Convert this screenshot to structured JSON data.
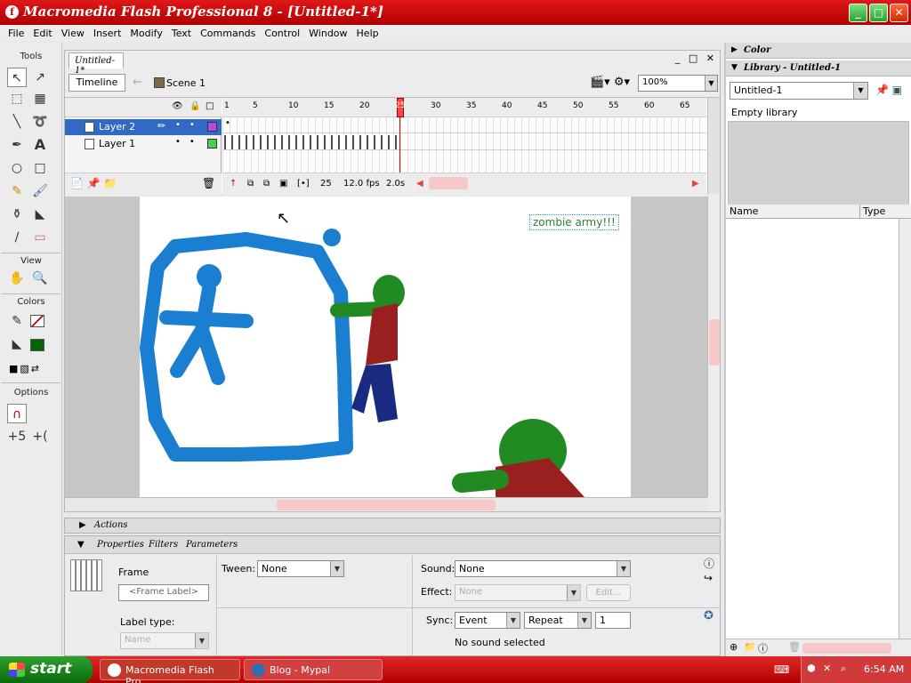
{
  "window": {
    "title": "Macromedia Flash Professional 8 - [Untitled-1*]",
    "app_icon": "f",
    "controls": [
      "_",
      "□",
      "✕"
    ]
  },
  "menu": [
    "File",
    "Edit",
    "View",
    "Insert",
    "Modify",
    "Text",
    "Commands",
    "Control",
    "Window",
    "Help"
  ],
  "tools": {
    "title": "Tools",
    "view_label": "View",
    "colors_label": "Colors",
    "options_label": "Options",
    "stroke_color": "#cc0000",
    "fill_color": "#006600"
  },
  "document": {
    "tab": "Untitled-1*",
    "controls": [
      "_",
      "□",
      "✕"
    ],
    "timeline_button": "Timeline",
    "scene": "Scene 1",
    "zoom": "100%"
  },
  "timeline": {
    "layers": [
      {
        "name": "Layer 2",
        "active": true,
        "swatch": "#b34de0"
      },
      {
        "name": "Layer 1",
        "active": false,
        "swatch": "#4cd04c"
      }
    ],
    "ticks": [
      "1",
      "5",
      "10",
      "15",
      "20",
      "25",
      "30",
      "35",
      "40",
      "45",
      "50",
      "55",
      "60",
      "65"
    ],
    "current_frame": "25",
    "fps": "12.0 fps",
    "time": "2.0s"
  },
  "stage": {
    "text": "zombie army!!!",
    "shape_blue": "#1a7fd0",
    "zombie_green": "#228a22",
    "zombie_red": "#9a2020",
    "zombie_navy": "#1a2a80"
  },
  "panels": {
    "actions": "Actions",
    "tabs": [
      "Properties",
      "Filters",
      "Parameters"
    ],
    "frame_label": "Frame",
    "frame_label_placeholder": "<Frame Label>",
    "label_type_label": "Label type:",
    "label_type_value": "Name",
    "tween_label": "Tween:",
    "tween_value": "None",
    "sound_label": "Sound:",
    "sound_value": "None",
    "effect_label": "Effect:",
    "effect_value": "None",
    "edit_button": "Edit...",
    "sync_label": "Sync:",
    "sync_value": "Event",
    "repeat_value": "Repeat",
    "repeat_count": "1",
    "no_sound": "No sound selected"
  },
  "right": {
    "color_panel": "Color",
    "library_panel": "Library - Untitled-1",
    "library_select": "Untitled-1",
    "empty_library": "Empty library",
    "col_name": "Name",
    "col_type": "Type"
  },
  "taskbar": {
    "start": "start",
    "tasks": [
      {
        "label": "Macromedia Flash Pro...",
        "color": "#c0392b"
      },
      {
        "label": "Blog - Mypal",
        "color": "#2f6fb0"
      }
    ],
    "clock": "6:54 AM"
  }
}
